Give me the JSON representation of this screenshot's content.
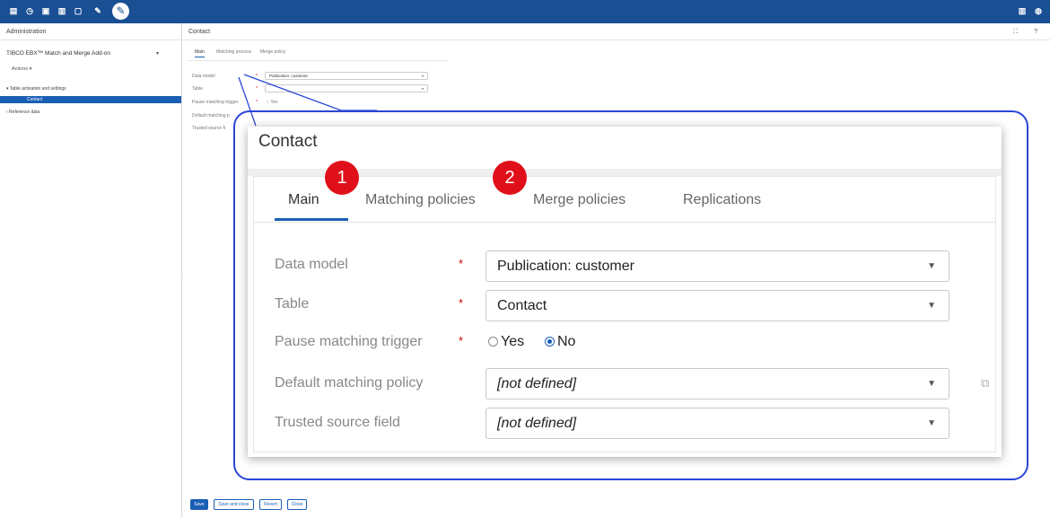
{
  "topbar": {
    "icons": [
      "database-icon",
      "clock-icon",
      "document-icon",
      "stack-icon",
      "file-icon",
      "pin-icon",
      "wrench-icon"
    ],
    "right_icons": [
      "bookmark-icon",
      "user-icon"
    ],
    "accent": "#1a4f94"
  },
  "left_panel": {
    "header": "Administration",
    "app_name": "TIBCO EBX™ Match and Merge Add-on",
    "actions_label": "Actions ▾",
    "tree": {
      "section": "▾ Table activation and settings",
      "selected_item": "Contact",
      "other_item": "› Reference data"
    }
  },
  "main_panel": {
    "header": "Contact",
    "header_icons": "⛶ ?",
    "small_tabs": [
      "Main",
      "Matching process",
      "Merge policy"
    ],
    "small_form": {
      "data_model_label": "Data model",
      "data_model_value": "Publication: customer",
      "table_label": "Table",
      "pause_label": "Pause matching trigger",
      "pause_value": "○ Yes",
      "default_policy_label": "Default matching p",
      "trusted_label": "Trusted source fi"
    },
    "buttons": {
      "save": "Save",
      "save_close": "Save and close",
      "revert": "Revert",
      "close": "Close"
    }
  },
  "zoom": {
    "title": "Contact",
    "tabs": [
      "Main",
      "Matching policies",
      "Merge policies",
      "Replications"
    ],
    "badges": [
      "1",
      "2"
    ],
    "fields": {
      "data_model": {
        "label": "Data model",
        "required": "*",
        "value": "Publication: customer"
      },
      "table": {
        "label": "Table",
        "required": "*",
        "value": "Contact"
      },
      "pause": {
        "label": "Pause matching trigger",
        "required": "*",
        "yes": "Yes",
        "no": "No",
        "selected": "No"
      },
      "default_policy": {
        "label": "Default matching policy",
        "value": "[not defined]"
      },
      "trusted_source": {
        "label": "Trusted source field",
        "value": "[not defined]"
      }
    },
    "colors": {
      "callout_border": "#2b46d6",
      "badge": "#e0101a",
      "tab_underline": "#1a5fb4"
    }
  }
}
